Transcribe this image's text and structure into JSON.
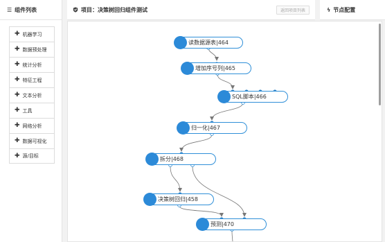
{
  "left_panel": {
    "title": "组件列表",
    "icon": "list-icon",
    "items": [
      "机器学习",
      "数据预处理",
      "统计分析",
      "特征工程",
      "文本分析",
      "工具",
      "网络分析",
      "数据可视化",
      "源/目标"
    ]
  },
  "center": {
    "title": "项目：决策树回归组件测试",
    "icon": "shield-icon",
    "back_button": "返回项目列表"
  },
  "right_panel": {
    "title": "节点配置",
    "icon": "bolt-icon"
  },
  "colors": {
    "node_border": "#2f8fd8",
    "node_dot": "#2c8ad8",
    "edge": "#777777",
    "port_in": "#2c7fc4"
  },
  "flow": {
    "nodes": [
      {
        "id": "n464",
        "label": "读数据源表|464"
      },
      {
        "id": "n465",
        "label": "增加序号列|465"
      },
      {
        "id": "n466",
        "label": "SQL脚本|466"
      },
      {
        "id": "n467",
        "label": "归一化|467"
      },
      {
        "id": "n468",
        "label": "拆分|468"
      },
      {
        "id": "n458",
        "label": "决策树回归|458"
      },
      {
        "id": "n470",
        "label": "预测|470"
      }
    ]
  }
}
